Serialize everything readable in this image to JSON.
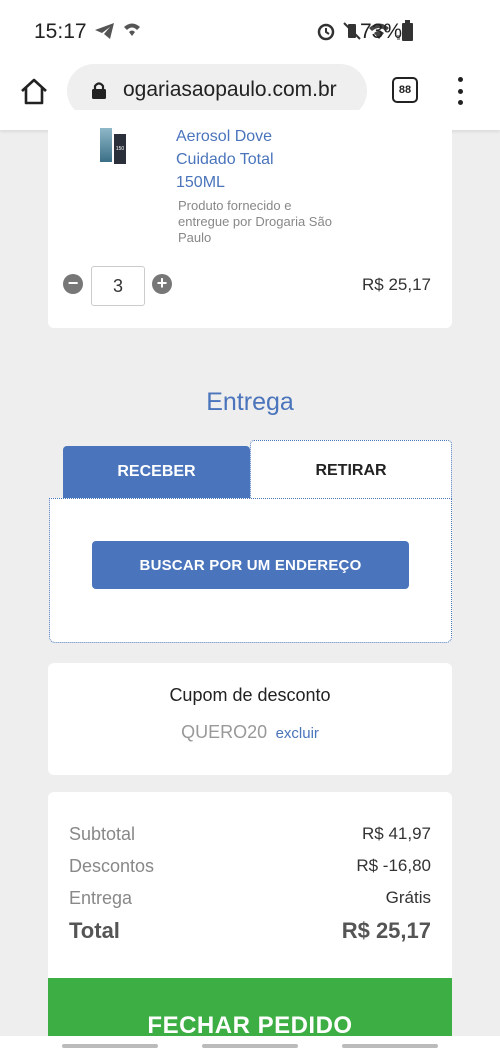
{
  "status_bar": {
    "time": "15:17",
    "battery": "73%"
  },
  "browser": {
    "url": "ogariasaopaulo.com.br",
    "tab_count": "88"
  },
  "product": {
    "name": "Aerosol Dove Cuidado Total 150ML",
    "seller": "Produto fornecido e entregue por Drogaria São Paulo",
    "quantity": "3",
    "minus_label": "−",
    "plus_label": "+",
    "price": "R$ 25,17",
    "image_label": "150"
  },
  "delivery": {
    "title": "Entrega",
    "tabs": [
      {
        "label": "RECEBER",
        "active": true
      },
      {
        "label": "RETIRAR",
        "active": false
      }
    ],
    "search_button": "BUSCAR POR UM ENDEREÇO"
  },
  "coupon": {
    "title": "Cupom de desconto",
    "code": "QUERO20",
    "remove_label": "excluir"
  },
  "summary": {
    "rows": [
      {
        "label": "Subtotal",
        "value": "R$ 41,97"
      },
      {
        "label": "Descontos",
        "value": "R$ -16,80"
      },
      {
        "label": "Entrega",
        "value": "Grátis"
      }
    ],
    "total_label": "Total",
    "total_value": "R$ 25,17"
  },
  "checkout_button": "FECHAR PEDIDO",
  "colors": {
    "accent": "#4a74bb",
    "checkout": "#3cae44",
    "background": "#eeeeee"
  }
}
